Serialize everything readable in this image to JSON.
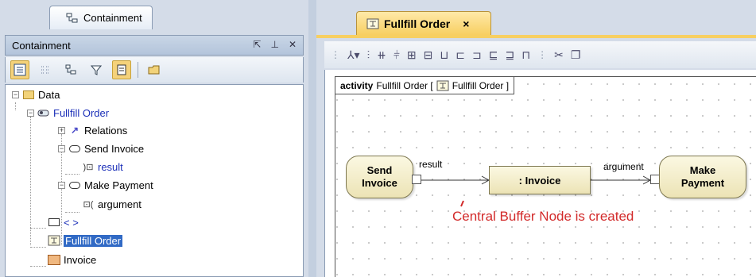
{
  "left_panel": {
    "tab_label": "Containment",
    "header_title": "Containment",
    "header_controls": [
      "⇱",
      "⊥",
      "✕"
    ],
    "toolbar_icons": [
      "collapse-all-icon",
      "expand-icon",
      "tree-view-icon",
      "filter-icon",
      "sync-icon",
      "new-folder-icon"
    ],
    "tree": [
      {
        "label": "Data"
      },
      {
        "label": "Fullfill Order"
      },
      {
        "label": "Relations"
      },
      {
        "label": "Send Invoice"
      },
      {
        "label": "result"
      },
      {
        "label": "Make Payment"
      },
      {
        "label": "argument"
      },
      {
        "label": "< >"
      },
      {
        "label": "Fullfill Order"
      },
      {
        "label": "Invoice"
      }
    ]
  },
  "editor": {
    "tab_label": "Fullfill Order",
    "tab_close": "×",
    "frame_label": {
      "kind": "activity",
      "name": "Fullfill Order [",
      "ref": "Fullfill Order ]"
    },
    "diagram": {
      "action_send": "Send Invoice",
      "action_pay": "Make Payment",
      "buffer": ": Invoice",
      "flow_in_label": "result",
      "flow_out_label": "argument",
      "annotation": "Central Buffer Node is created",
      "annotation_color": "#d22a2a"
    }
  },
  "colors": {
    "panel_bg": "#d4dce8",
    "active_tab": "#f7cf61",
    "selection": "#316ac5",
    "tree_link": "#1b2fb8"
  }
}
